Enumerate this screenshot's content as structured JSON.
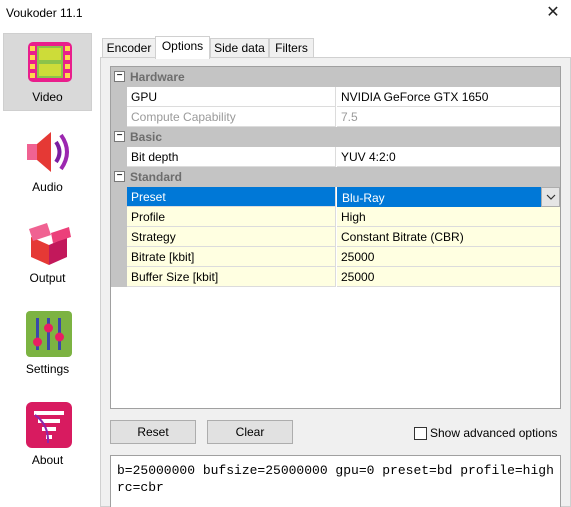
{
  "window": {
    "title": "Voukoder 11.1",
    "close_glyph": "✕"
  },
  "sidebar": {
    "items": [
      {
        "label": "Video",
        "icon": "film-icon",
        "active": true
      },
      {
        "label": "Audio",
        "icon": "speaker-icon",
        "active": false
      },
      {
        "label": "Output",
        "icon": "box-icon",
        "active": false
      },
      {
        "label": "Settings",
        "icon": "sliders-icon",
        "active": false
      },
      {
        "label": "About",
        "icon": "tornado-icon",
        "active": false
      }
    ]
  },
  "tabs": [
    {
      "label": "Encoder",
      "active": false
    },
    {
      "label": "Options",
      "active": true
    },
    {
      "label": "Side data",
      "active": false
    },
    {
      "label": "Filters",
      "active": false
    }
  ],
  "grid": {
    "categories": {
      "hardware": {
        "label": "Hardware",
        "toggle": "⊟"
      },
      "basic": {
        "label": "Basic",
        "toggle": "⊟"
      },
      "standard": {
        "label": "Standard",
        "toggle": "⊟"
      }
    },
    "rows": {
      "gpu": {
        "name": "GPU",
        "value": "NVIDIA GeForce GTX 1650"
      },
      "compute": {
        "name": "Compute Capability",
        "value": "7.5"
      },
      "bitdepth": {
        "name": "Bit depth",
        "value": "YUV 4:2:0"
      },
      "preset": {
        "name": "Preset",
        "value": "Blu-Ray"
      },
      "profile": {
        "name": "Profile",
        "value": "High"
      },
      "strategy": {
        "name": "Strategy",
        "value": "Constant Bitrate (CBR)"
      },
      "bitrate": {
        "name": "Bitrate [kbit]",
        "value": "25000"
      },
      "buffer": {
        "name": "Buffer Size [kbit]",
        "value": "25000"
      }
    }
  },
  "buttons": {
    "reset": "Reset",
    "clear": "Clear"
  },
  "advanced": {
    "label": "Show advanced options",
    "checked": false
  },
  "command_line": "b=25000000 bufsize=25000000 gpu=0 preset=bd profile=high rc=cbr",
  "colors": {
    "accent": "#0078d7",
    "category_bg": "#c4c4c4",
    "highlight_row": "#ffffe1"
  }
}
